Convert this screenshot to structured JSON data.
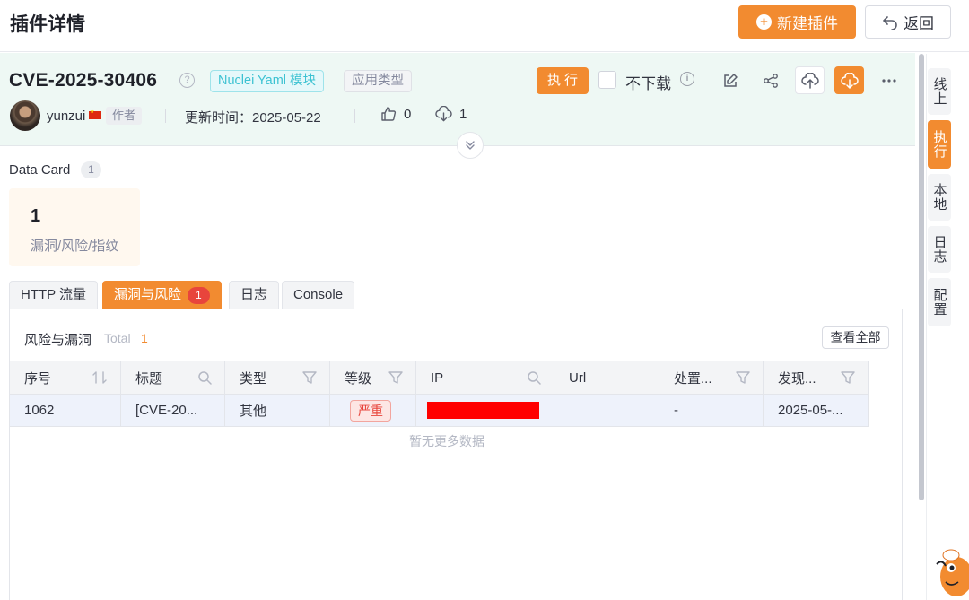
{
  "header": {
    "title": "插件详情",
    "new_plugin_label": "新建插件",
    "back_label": "返回"
  },
  "plugin": {
    "title": "CVE-2025-30406",
    "tag_module": "Nuclei Yaml 模块",
    "tag_type": "应用类型",
    "exec_label": "执行",
    "no_download_label": "不下载",
    "author": "yunzui",
    "author_tag": "作者",
    "updated": "更新时间：2025-05-22",
    "likes": "0",
    "downloads": "1"
  },
  "data_card": {
    "title": "Data Card",
    "count": "1",
    "value": "1",
    "label": "漏洞/风险/指纹"
  },
  "tabs": [
    {
      "label": "HTTP 流量",
      "active": false
    },
    {
      "label": "漏洞与风险",
      "active": true,
      "badge": "1"
    },
    {
      "label": "日志",
      "active": false
    },
    {
      "label": "Console",
      "active": false
    }
  ],
  "risk_panel": {
    "title": "风险与漏洞",
    "total_label": "Total",
    "total_value": "1",
    "view_all_label": "查看全部",
    "columns": [
      "序号",
      "标题",
      "类型",
      "等级",
      "IP",
      "Url",
      "处置...",
      "发现..."
    ],
    "rows": [
      {
        "id": "1062",
        "title": "[CVE-20...",
        "type": "其他",
        "level": "严重",
        "ip": "",
        "url": "",
        "status": "-",
        "found": "2025-05-..."
      }
    ],
    "empty_message": "暂无更多数据"
  },
  "right_rail": [
    "线上",
    "执行",
    "本地",
    "日志",
    "配置"
  ],
  "colors": {
    "accent": "#f28b30",
    "severity_critical": "#e8453c",
    "info_bg": "#eef8f4"
  }
}
